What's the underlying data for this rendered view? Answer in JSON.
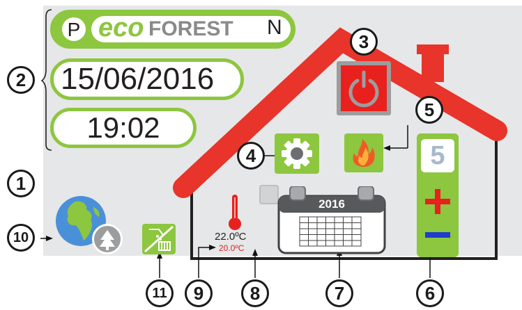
{
  "brand": {
    "p_label": "P",
    "logo_prefix": "eco",
    "logo_suffix": "FOREST",
    "n_label": "N"
  },
  "date": "15/06/2016",
  "time": "19:02",
  "power_button": {
    "icon": "power-icon",
    "color": "#e8211e"
  },
  "settings_button": {
    "icon": "gear-icon"
  },
  "flame_button": {
    "icon": "flame-icon"
  },
  "power_level": {
    "value": "5",
    "plus": "+",
    "minus": "−"
  },
  "calendar": {
    "year": "2016"
  },
  "temperature": {
    "current": "22.0ºC",
    "setpoint": "20.0ºC"
  },
  "callouts": [
    "1",
    "2",
    "3",
    "4",
    "5",
    "6",
    "7",
    "8",
    "9",
    "10",
    "11"
  ],
  "colors": {
    "accent": "#8dc63f",
    "roof": "#e8342a",
    "red": "#e8211e",
    "minus": "#1e3fc8",
    "setpoint": "#d7261e"
  }
}
